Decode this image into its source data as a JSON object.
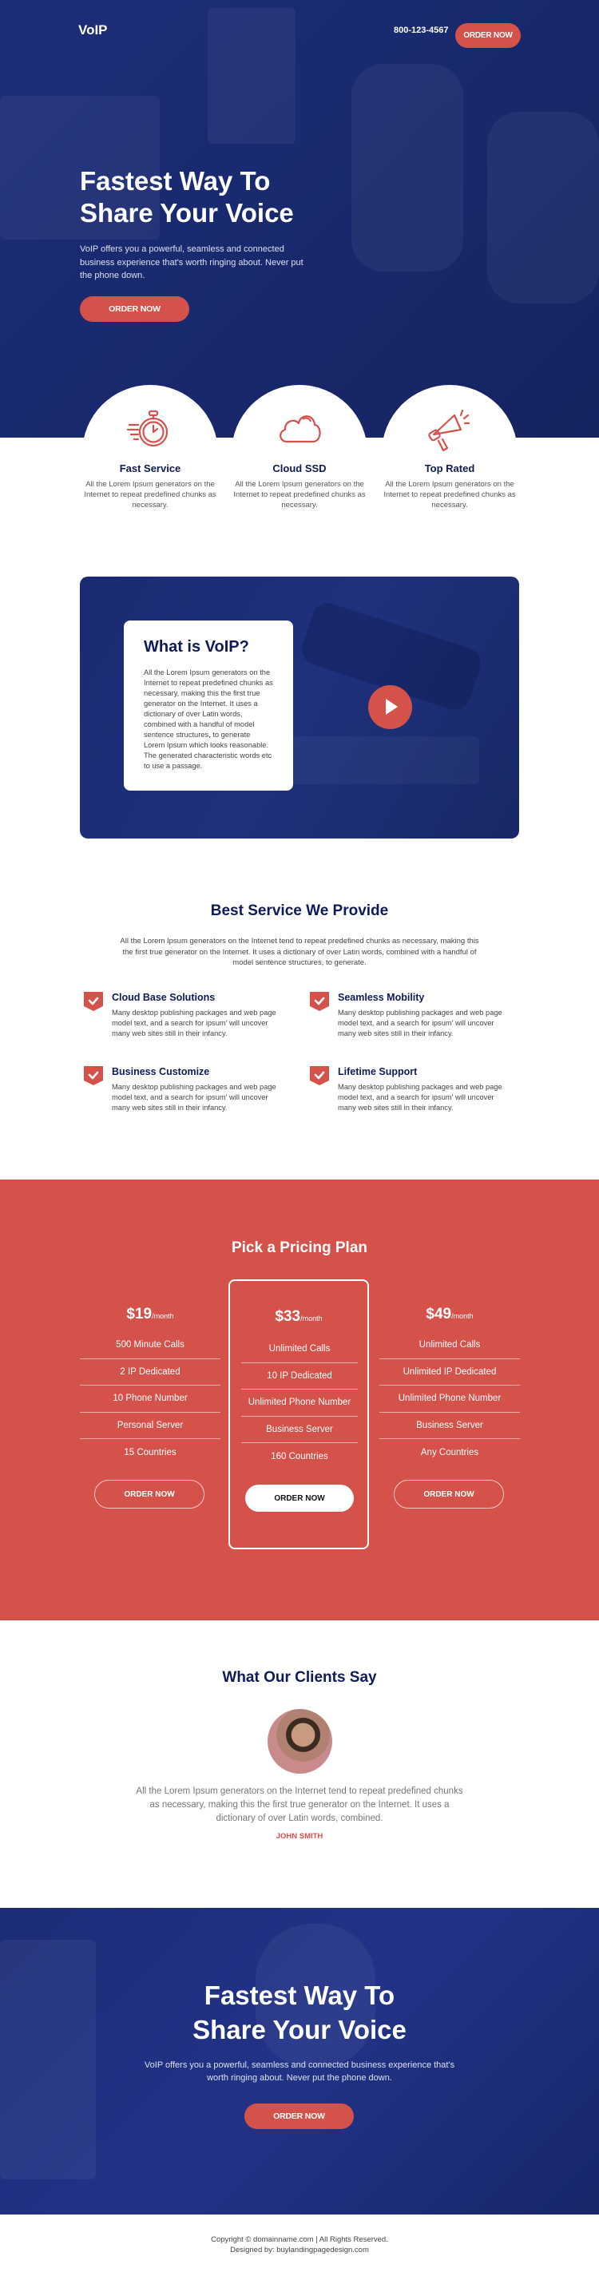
{
  "header": {
    "logo": "VoIP",
    "phone": "800-123-4567",
    "cta": "ORDER NOW"
  },
  "hero": {
    "title_line1": "Fastest Way To",
    "title_line2": "Share Your Voice",
    "text": "VoIP offers you a powerful, seamless and connected business experience that's worth ringing about. Never put the phone down.",
    "cta": "ORDER NOW"
  },
  "features": [
    {
      "icon": "stopwatch-icon",
      "title": "Fast Service",
      "text": "All the Lorem Ipsum generators on the Internet to repeat predefined chunks as necessary."
    },
    {
      "icon": "cloud-icon",
      "title": "Cloud SSD",
      "text": "All the Lorem Ipsum generators on the Internet to repeat predefined chunks as necessary."
    },
    {
      "icon": "megaphone-icon",
      "title": "Top Rated",
      "text": "All the Lorem Ipsum generators on the Internet to repeat predefined chunks as necessary."
    }
  ],
  "video": {
    "title": "What is VoIP?",
    "text": "All the Lorem Ipsum generators on the Internet to repeat predefined chunks as necessary, making this the first true generator on the Internet. It uses a dictionary of over Latin words, combined with a handful of model sentence structures, to generate Lorem Ipsum which looks reasonable. The generated characteristic words etc to use a passage."
  },
  "services": {
    "title": "Best Service We Provide",
    "text": "All the Lorem Ipsum generators on the Internet tend to repeat predefined chunks as necessary, making this the first true generator on the Internet. It uses a dictionary of over Latin words, combined with a handful of model sentence structures, to generate.",
    "items": [
      {
        "title": "Cloud Base Solutions",
        "text": "Many desktop publishing packages and web page model text, and a search for ipsum' will uncover many web sites still in their infancy."
      },
      {
        "title": "Seamless Mobility",
        "text": "Many desktop publishing packages and web page model text, and a search for ipsum' will uncover many web sites still in their infancy."
      },
      {
        "title": "Business Customize",
        "text": "Many desktop publishing packages and web page model text, and a search for ipsum' will uncover many web sites still in their infancy."
      },
      {
        "title": "Lifetime Support",
        "text": "Many desktop publishing packages and web page model text, and a search for ipsum' will uncover many web sites still in their infancy."
      }
    ]
  },
  "pricing": {
    "title": "Pick a Pricing Plan",
    "period": "/month",
    "plans": [
      {
        "price": "$19",
        "features": [
          "500 Minute Calls",
          "2 IP Dedicated",
          "10 Phone Number",
          "Personal Server",
          "15 Countries"
        ],
        "cta": "ORDER NOW"
      },
      {
        "price": "$33",
        "features": [
          "Unlimited Calls",
          "10 IP Dedicated",
          "Unlimited Phone Number",
          "Business Server",
          "160 Countries"
        ],
        "cta": "ORDER NOW"
      },
      {
        "price": "$49",
        "features": [
          "Unlimited Calls",
          "Unlimited IP Dedicated",
          "Unlimited Phone Number",
          "Business Server",
          "Any Countries"
        ],
        "cta": "ORDER NOW"
      }
    ]
  },
  "testimonials": {
    "title": "What Our Clients Say",
    "text": "All the Lorem Ipsum generators on the Internet tend to repeat predefined chunks as necessary, making this the first true generator on the Internet. It uses a dictionary of over Latin words, combined.",
    "name": "JOHN SMITH"
  },
  "cta": {
    "title_line1": "Fastest Way To",
    "title_line2": "Share Your Voice",
    "text": "VoIP offers you a powerful, seamless and connected business experience that's worth ringing about. Never put the phone down.",
    "button": "ORDER NOW"
  },
  "footer": {
    "copyright": "Copyright © domainname.com | All Rights Reserved.",
    "designed": "Designed by: buylandingpagedesign.com"
  },
  "colors": {
    "navy": "#1d2d7a",
    "red": "#d5524a",
    "heading": "#0f1a5a"
  }
}
